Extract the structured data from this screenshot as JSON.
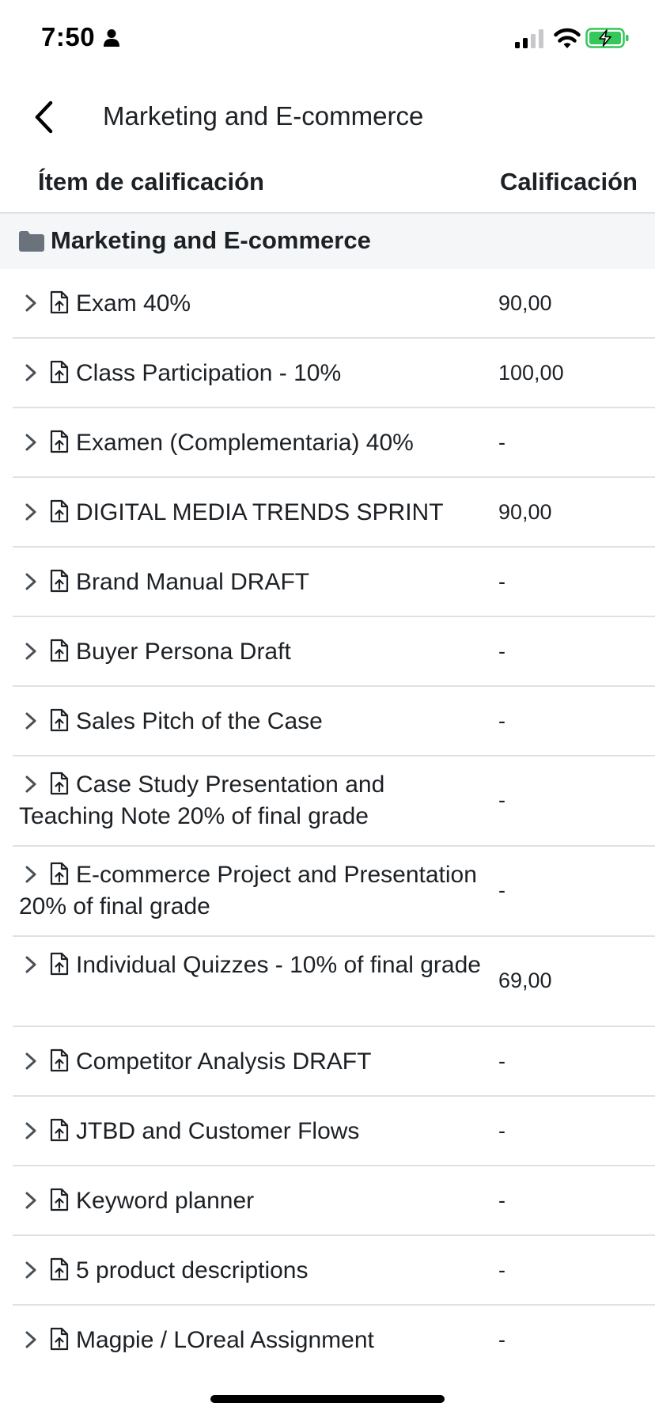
{
  "status_bar": {
    "time": "7:50",
    "battery_color": "#34c759"
  },
  "header": {
    "title": "Marketing and E-commerce"
  },
  "columns": {
    "item": "Ítem de calificación",
    "grade": "Calificación"
  },
  "category": {
    "label": "Marketing and E-commerce",
    "icon": "folder-icon"
  },
  "rows": [
    {
      "name": "Exam 40%",
      "grade": "90,00"
    },
    {
      "name": "Class Participation - 10%",
      "grade": "100,00"
    },
    {
      "name": "Examen (Complementaria) 40%",
      "grade": "-"
    },
    {
      "name": "DIGITAL MEDIA TRENDS SPRINT",
      "grade": "90,00"
    },
    {
      "name": "Brand Manual DRAFT",
      "grade": "-"
    },
    {
      "name": "Buyer Persona Draft",
      "grade": "-"
    },
    {
      "name": "Sales Pitch of the Case",
      "grade": "-"
    },
    {
      "name": "Case Study Presentation and Teaching Note 20% of final grade",
      "grade": "-"
    },
    {
      "name": "E-commerce Project and Presentation 20% of final grade",
      "grade": "-"
    },
    {
      "name": "Individual Quizzes - 10% of final grade",
      "grade": "69,00"
    },
    {
      "name": "Competitor Analysis DRAFT",
      "grade": "-"
    },
    {
      "name": "JTBD and Customer Flows",
      "grade": "-"
    },
    {
      "name": "Keyword planner",
      "grade": "-"
    },
    {
      "name": "5 product descriptions",
      "grade": "-"
    },
    {
      "name": "Magpie / LOreal Assignment",
      "grade": "-"
    }
  ],
  "icons": {
    "row_expand": "chevron-right-icon",
    "row_type": "assignment-upload-icon",
    "back": "chevron-left-icon"
  }
}
